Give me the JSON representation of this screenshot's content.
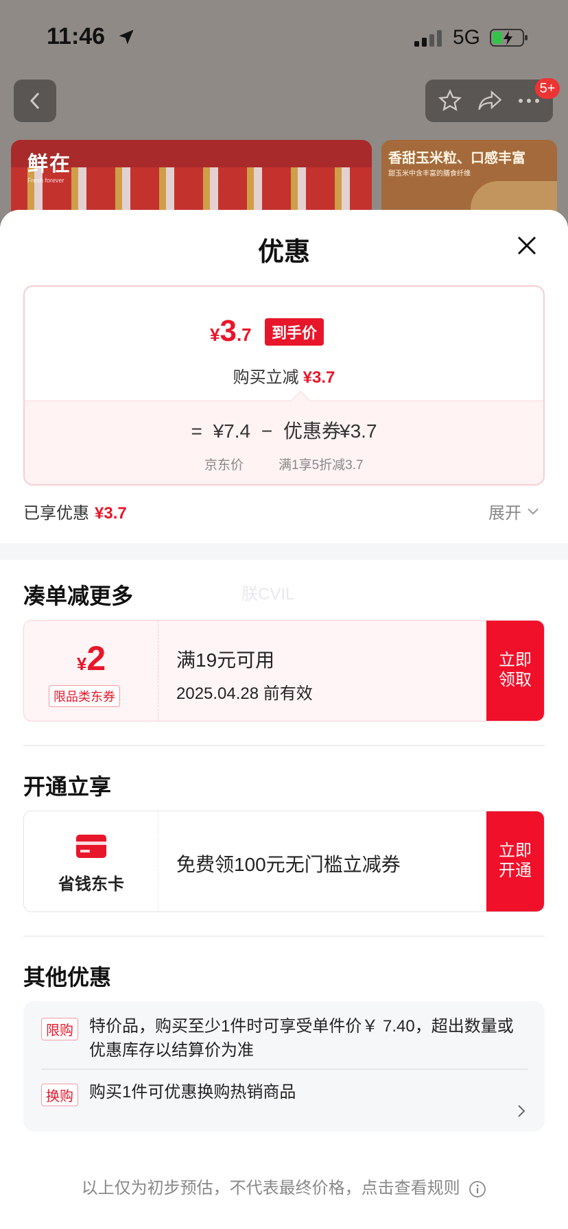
{
  "status_bar": {
    "time": "11:46",
    "network": "5G"
  },
  "background": {
    "banner_left_logo": "鲜在",
    "banner_left_logo_sub": "Fresh forever",
    "banner_right_title": "香甜玉米粒、口感丰富",
    "banner_right_sub": "甜玉米中含丰富的膳食纤维",
    "cart_badge": "5+"
  },
  "sheet": {
    "title": "优惠",
    "final_price": {
      "yen": "¥",
      "int": "3",
      "dec": ".7",
      "tag": "到手价"
    },
    "buy_reduce": {
      "label": "购买立减",
      "amount": "¥3.7"
    },
    "calc": {
      "equals": "=",
      "jd_price": "¥7.4",
      "minus": "−",
      "coupon_label": "优惠券",
      "coupon_amount": "¥3.7",
      "jd_price_label": "京东价",
      "coupon_desc": "满1享5折减3.7"
    },
    "enjoyed": {
      "label": "已享优惠",
      "amount": "¥3.7"
    },
    "expand_label": "展开"
  },
  "section_more": {
    "title": "凑单减更多",
    "watermark": "朕CVIL",
    "coupon": {
      "yen": "¥",
      "amount": "2",
      "tag": "限品类东券",
      "condition": "满19元可用",
      "validity": "2025.04.28 前有效",
      "button": "立即领取"
    }
  },
  "section_open": {
    "title": "开通立享",
    "card_label": "省钱东卡",
    "offer": "免费领100元无门槛立减券",
    "button": "立即开通"
  },
  "section_other": {
    "title": "其他优惠",
    "items": [
      {
        "tag": "限购",
        "text": "特价品，购买至少1件时可享受单件价￥ 7.40，超出数量或优惠库存以结算价为准"
      },
      {
        "tag": "换购",
        "text": "购买1件可优惠换购热销商品"
      }
    ]
  },
  "footer": {
    "note": "以上仅为初步预估，不代表最终价格，点击查看规则"
  },
  "colors": {
    "accent": "#e8162a",
    "button_red": "#f0102a"
  }
}
